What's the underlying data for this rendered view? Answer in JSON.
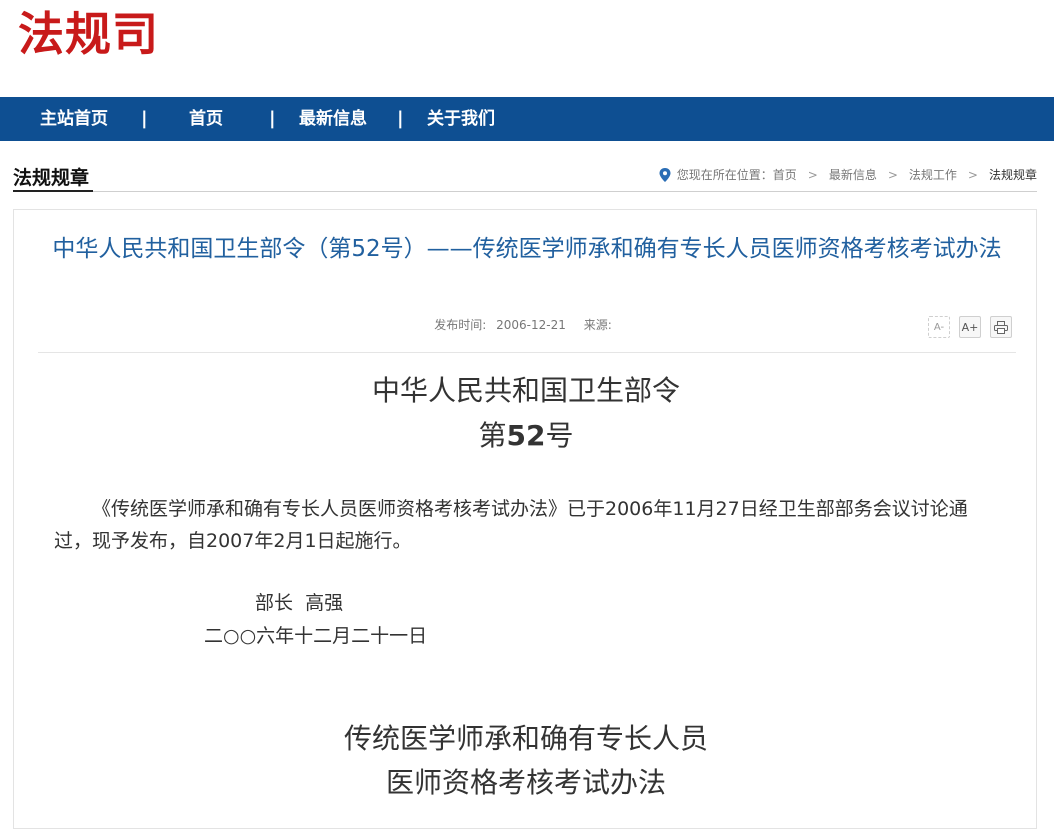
{
  "site": {
    "logo_text": "法规司",
    "brand_color": "#c81a1a",
    "nav_color": "#0e4f92"
  },
  "nav": {
    "items": [
      {
        "label": "主站首页"
      },
      {
        "label": "首页"
      },
      {
        "label": "最新信息"
      },
      {
        "label": "关于我们"
      }
    ],
    "separator": "|"
  },
  "section": {
    "title": "法规规章"
  },
  "breadcrumb": {
    "prefix": "您现在所在位置：",
    "items": [
      "首页",
      "最新信息",
      "法规工作",
      "法规规章"
    ],
    "separator": ">",
    "icon": "location-pin-icon"
  },
  "article": {
    "title": "中华人民共和国卫生部令（第52号）——传统医学师承和确有专长人员医师资格考核考试办法",
    "title_color": "#21609f",
    "meta": {
      "published_label": "发布时间:",
      "published_value": "2006-12-21",
      "source_label": "来源:"
    },
    "tools": {
      "font_smaller": "A-",
      "font_larger": "A+",
      "print_icon": "printer-icon"
    },
    "decree_heading": "中华人民共和国卫生部令",
    "decree_number_prefix": "第",
    "decree_number": "52",
    "decree_number_suffix": "号",
    "body_paragraph": "《传统医学师承和确有专长人员医师资格考核考试办法》已于2006年11月27日经卫生部部务会议讨论通过，现予发布，自2007年2月1日起施行。",
    "signer": "部长  高强",
    "sign_date": "二○○六年十二月二十一日",
    "subtitle_line1": "传统医学师承和确有专长人员",
    "subtitle_line2": "医师资格考核考试办法"
  }
}
